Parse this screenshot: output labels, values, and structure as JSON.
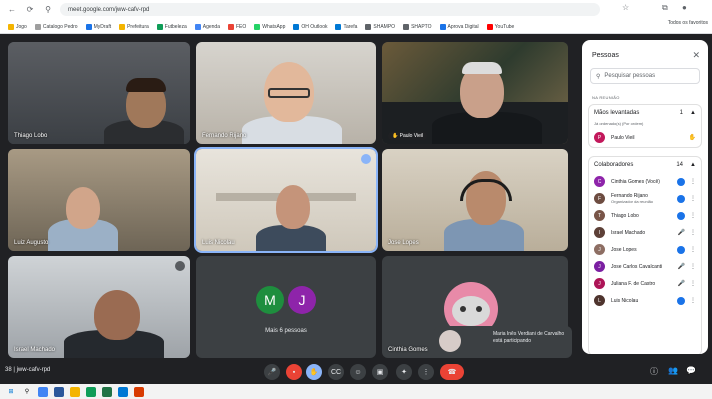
{
  "browser": {
    "url": "meet.google.com/jww-cafv-rpd",
    "bookmarks": [
      "Jogo",
      "Catalogo Pedro",
      "MyDraft",
      "Prefeitura",
      "Futbeleza",
      "Agenda",
      "FEO",
      "WhatsApp",
      "OH Outlook",
      "Tarefa",
      "SHAMPO",
      "SHAPTO",
      "Aprova Digital",
      "YouTube"
    ],
    "bookmarks_right": "Todos os favoritos"
  },
  "tiles": [
    {
      "name": "Thiago Lobo"
    },
    {
      "name": "Fernando Rijano"
    },
    {
      "name": "Paulo Vieil"
    },
    {
      "name": "Luiz Augusto"
    },
    {
      "name": "Luis Nicolau"
    },
    {
      "name": "Jose Lopes"
    },
    {
      "name": "Israel Machado"
    },
    {
      "name": "Mais 6 pessoas",
      "avatars": [
        "M",
        "J"
      ]
    },
    {
      "name": "Cinthia Gomes"
    }
  ],
  "toast": {
    "text": "Maria Inês Verdiani de Carvalho está participando"
  },
  "people_panel": {
    "title": "Pessoas",
    "search_placeholder": "Pesquisar pessoas",
    "section_caption": "NA REUNIÃO",
    "groups": [
      {
        "name": "Mãos levantadas",
        "count": "1",
        "subtitle": "Já ordenado(s) (Por ordem)",
        "people": [
          {
            "name": "Paulo Vieil",
            "initial": "P",
            "color": "#c2185b"
          }
        ]
      },
      {
        "name": "Colaboradores",
        "count": "14",
        "people": [
          {
            "name": "Cinthia Gomes (Você)",
            "initial": "C",
            "color": "#8e24aa"
          },
          {
            "name": "Fernando Rijano",
            "sub": "Organizador da reunião",
            "initial": "F",
            "color": "#6d4c41"
          },
          {
            "name": "Thiago Lobo",
            "initial": "T",
            "color": "#795548"
          },
          {
            "name": "Israel Machado",
            "initial": "I",
            "color": "#5d4037"
          },
          {
            "name": "Jose Lopes",
            "initial": "J",
            "color": "#8d6e63"
          },
          {
            "name": "Jose Carlos Cavalcanti",
            "initial": "J",
            "color": "#7b1fa2"
          },
          {
            "name": "Juliana F. de Castro",
            "initial": "J",
            "color": "#ad1457"
          },
          {
            "name": "Luis Nicolau",
            "initial": "L",
            "color": "#4e342e"
          }
        ]
      }
    ]
  },
  "bottom_bar": {
    "meeting_code": "jww-cafv-rpd",
    "time": "38"
  },
  "colors": {
    "meet_bg": "#202124",
    "accent": "#1a73e8",
    "danger": "#ea4335"
  }
}
